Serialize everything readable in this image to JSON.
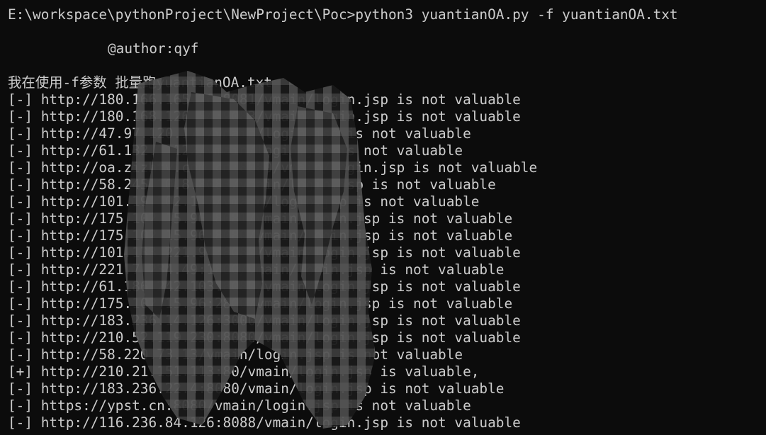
{
  "terminal": {
    "command_line": "E:\\workspace\\pythonProject\\NewProject\\Poc>python3 yuantianOA.py -f yuantianOA.txt",
    "author": "@author:qyf",
    "info_line": "我在使用-f参数 批量跑yuantianOA.txt",
    "results": [
      "[-] http://180.166.165.26:8081/vmain/login.jsp is not valuable",
      "[-] http://180.168.126.54:9083/vmain/login.jsp is not valuable",
      "[-] http://47.97.120.171/vmain/login.jsp is not valuable",
      "[-] http://61.132.1.122/vmain/login.jsp is not valuable",
      "[-] http://oa.zizhtv.com.cn:8080/vmain/login.jsp is not valuable",
      "[-] http://58.245.10.8:8083/vmain/login.jsp is not valuable",
      "[-] http://101.19.102.117/vmain/login.jsp is not valuable",
      "[-] http://175.102.15.96:8081/vmain/login.jsp is not valuable",
      "[-] http://175.102.15.96:8080/vmain/login.jsp is not valuable",
      "[-] http://101.133.221.94:8080/vmain/login.jsp is not valuable",
      "[-] http://221.7.234.49:1800/vmain/login.jsp is not valuable",
      "[-] http://61.186.242.103:8080/vmain/login.jsp is not valuable",
      "[-] http://175.102.15.96:2800/vmain/login.jsp is not valuable",
      "[-] http://183.236.14.126:3000/vmain/login.jsp is not valuable",
      "[-] http://210.52.119.230:8080/vmain/login.jsp is not valuable",
      "[-] http://58.220.73.13/vmain/login.jsp is not valuable",
      "[+] http://210.21.151.113:80/vmain/login.jsp is valuable,",
      "[-] http://183.236.22.4:8080/vmain/login.jsp is not valuable",
      "[-] https://ypst.cn:8080/vmain/login.jsp is not valuable",
      "[-] http://116.236.84.126:8088/vmain/login.jsp is not valuable"
    ]
  }
}
